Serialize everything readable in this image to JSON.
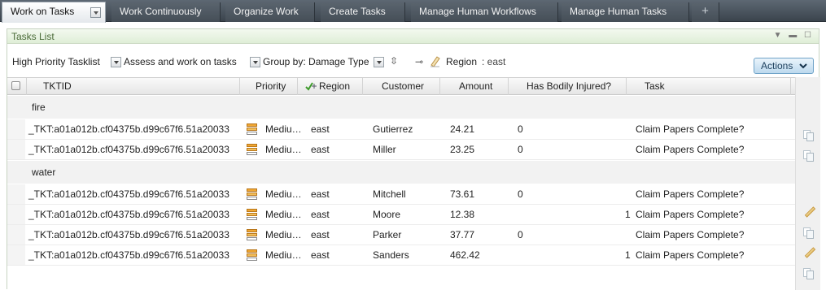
{
  "tabs": [
    {
      "label": "Work on Tasks",
      "active": true
    },
    {
      "label": "Work Continuously"
    },
    {
      "label": "Organize Work"
    },
    {
      "label": "Create Tasks"
    },
    {
      "label": "Manage Human Workflows"
    },
    {
      "label": "Manage Human Tasks"
    },
    {
      "label": "+"
    }
  ],
  "panel": {
    "title": "Tasks List",
    "controls": "▼ ▬ ☐"
  },
  "toolbar": {
    "tasklist": "High Priority Tasklist",
    "view": "Assess and work on tasks",
    "group_by": "Group by: Damage Type",
    "sort_icon": "⇳",
    "link_icon": "⊸",
    "region_label": "Region",
    "region_value": ": east",
    "actions_label": "Actions"
  },
  "columns": [
    "TKTID",
    "Priority",
    "Region",
    "Customer",
    "Amount",
    "Has Bodily Injured?",
    "Task"
  ],
  "groups": [
    {
      "name": "fire",
      "rows": [
        {
          "tktid": "_TKT:a01a012b.cf04375b.d99c67f6.51a20033",
          "priority": "Mediu…",
          "region": "east",
          "customer": "Gutierrez",
          "amount": "24.21",
          "bodily_left": "0",
          "bodily_right": "",
          "task": "Claim Papers Complete?",
          "side_icon": "copy-icon"
        },
        {
          "tktid": "_TKT:a01a012b.cf04375b.d99c67f6.51a20033",
          "priority": "Mediu…",
          "region": "east",
          "customer": "Miller",
          "amount": "23.25",
          "bodily_left": "0",
          "bodily_right": "",
          "task": "Claim Papers Complete?",
          "side_icon": "copy-icon"
        }
      ]
    },
    {
      "name": "water",
      "rows": [
        {
          "tktid": "_TKT:a01a012b.cf04375b.d99c67f6.51a20033",
          "priority": "Mediu…",
          "region": "east",
          "customer": "Mitchell",
          "amount": "73.61",
          "bodily_left": "0",
          "bodily_right": "",
          "task": "Claim Papers Complete?",
          "side_icon": "pencil-icon"
        },
        {
          "tktid": "_TKT:a01a012b.cf04375b.d99c67f6.51a20033",
          "priority": "Mediu…",
          "region": "east",
          "customer": "Moore",
          "amount": "12.38",
          "bodily_left": "",
          "bodily_right": "1",
          "task": "Claim Papers Complete?",
          "side_icon": "copy-icon"
        },
        {
          "tktid": "_TKT:a01a012b.cf04375b.d99c67f6.51a20033",
          "priority": "Mediu…",
          "region": "east",
          "customer": "Parker",
          "amount": "37.77",
          "bodily_left": "0",
          "bodily_right": "",
          "task": "Claim Papers Complete?",
          "side_icon": "pencil-icon"
        },
        {
          "tktid": "_TKT:a01a012b.cf04375b.d99c67f6.51a20033",
          "priority": "Mediu…",
          "region": "east",
          "customer": "Sanders",
          "amount": "462.42",
          "bodily_left": "",
          "bodily_right": "1",
          "task": "Claim Papers Complete?",
          "side_icon": "copy-icon"
        }
      ]
    }
  ]
}
